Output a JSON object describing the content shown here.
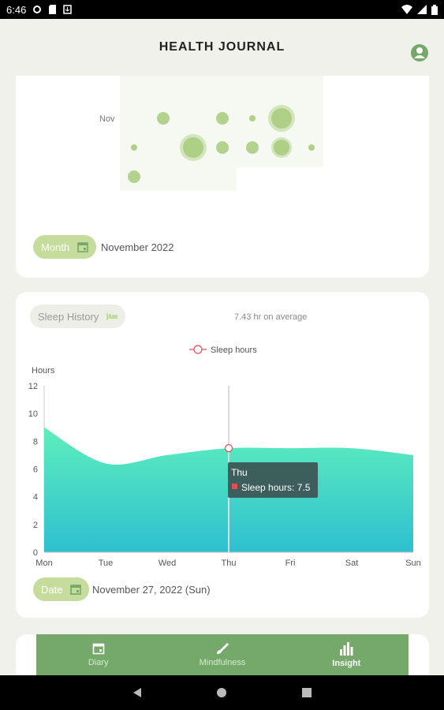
{
  "status_bar": {
    "time": "6:46"
  },
  "header": {
    "title": "HEALTH JOURNAL"
  },
  "bubble_card": {
    "row_label": "Nov",
    "period_pill_label": "Month",
    "period_value": "November 2022"
  },
  "sleep_card": {
    "pill_label": "Sleep History",
    "average_text": "7.43 hr on average",
    "legend_label": "Sleep hours",
    "y_axis_title": "Hours",
    "tooltip_title": "Thu",
    "tooltip_value": "Sleep hours: 7.5",
    "date_pill_label": "Date",
    "date_value": "November 27, 2022 (Sun)"
  },
  "chart_data": {
    "type": "area",
    "categories": [
      "Mon",
      "Tue",
      "Wed",
      "Thu",
      "Fri",
      "Sat",
      "Sun"
    ],
    "series": [
      {
        "name": "Sleep hours",
        "values": [
          9,
          6.4,
          7,
          7.5,
          7.5,
          7.5,
          7
        ]
      }
    ],
    "ylabel": "Hours",
    "ylim": [
      0,
      12
    ],
    "yticks": [
      0,
      2,
      4,
      6,
      8,
      10,
      12
    ],
    "highlighted_point": {
      "category": "Thu",
      "value": 7.5
    },
    "colors": {
      "top": "#5eeebc",
      "bottom": "#2ec0d0"
    }
  },
  "nav": {
    "items": [
      {
        "label": "Diary"
      },
      {
        "label": "Mindfulness"
      },
      {
        "label": "Insight"
      }
    ]
  },
  "colors": {
    "accent": "#74a96a",
    "pill": "#c5dc9c",
    "bubble": "#a7cb7d"
  }
}
